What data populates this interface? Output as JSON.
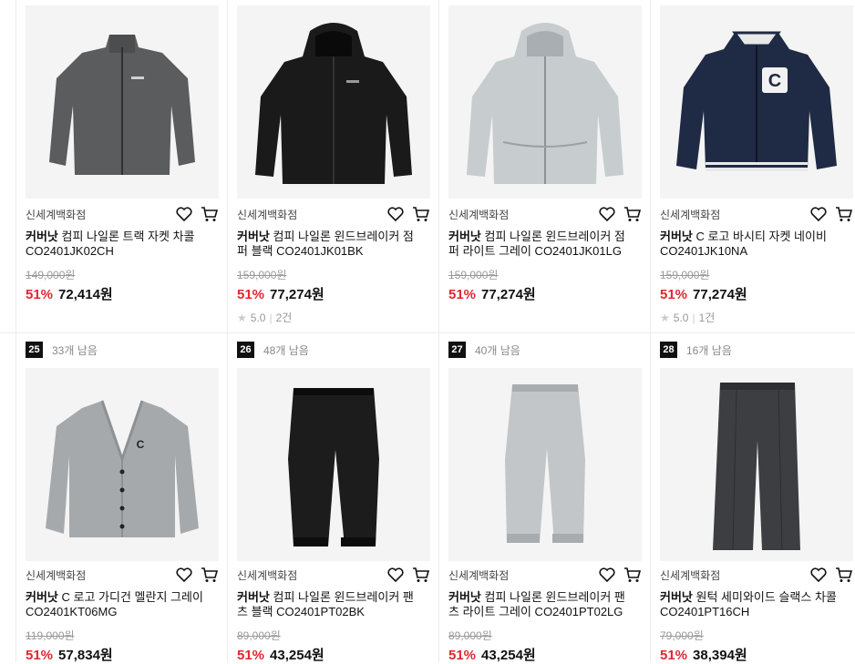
{
  "products": [
    {
      "rank": "",
      "stock": "",
      "seller": "신세계백화점",
      "brand": "커버낫",
      "name": " 컴피 나일론 트랙 자켓 차콜 CO2401JK02CH",
      "orig": "149,000원",
      "rate": "51%",
      "price": "72,414원",
      "rating": "",
      "reviews": "",
      "image": "track-jacket-charcoal"
    },
    {
      "rank": "",
      "stock": "",
      "seller": "신세계백화점",
      "brand": "커버낫",
      "name": " 컴피 나일론 윈드브레이커 점퍼 블랙 CO2401JK01BK",
      "orig": "159,000원",
      "rate": "51%",
      "price": "77,274원",
      "rating": "5.0",
      "reviews": "2건",
      "image": "windbreaker-black"
    },
    {
      "rank": "",
      "stock": "",
      "seller": "신세계백화점",
      "brand": "커버낫",
      "name": " 컴피 나일론 윈드브레이커 점퍼 라이트 그레이 CO2401JK01LG",
      "orig": "159,000원",
      "rate": "51%",
      "price": "77,274원",
      "rating": "",
      "reviews": "",
      "image": "windbreaker-grey"
    },
    {
      "rank": "",
      "stock": "",
      "seller": "신세계백화점",
      "brand": "커버낫",
      "name": " C 로고 바시티 자켓 네이비 CO2401JK10NA",
      "orig": "159,000원",
      "rate": "51%",
      "price": "77,274원",
      "rating": "5.0",
      "reviews": "1건",
      "image": "varsity-navy"
    },
    {
      "rank": "25",
      "stock": "33개 남음",
      "seller": "신세계백화점",
      "brand": "커버낫",
      "name": " C 로고 가디건 멜란지 그레이 CO2401KT06MG",
      "orig": "119,000원",
      "rate": "51%",
      "price": "57,834원",
      "rating": "",
      "reviews": "",
      "image": "cardigan-grey"
    },
    {
      "rank": "26",
      "stock": "48개 남음",
      "seller": "신세계백화점",
      "brand": "커버낫",
      "name": " 컴피 나일론 윈드브레이커 팬츠 블랙 CO2401PT02BK",
      "orig": "89,000원",
      "rate": "51%",
      "price": "43,254원",
      "rating": "",
      "reviews": "",
      "image": "pants-black"
    },
    {
      "rank": "27",
      "stock": "40개 남음",
      "seller": "신세계백화점",
      "brand": "커버낫",
      "name": " 컴피 나일론 윈드브레이커 팬츠 라이트 그레이 CO2401PT02LG",
      "orig": "89,000원",
      "rate": "51%",
      "price": "43,254원",
      "rating": "",
      "reviews": "",
      "image": "pants-grey"
    },
    {
      "rank": "28",
      "stock": "16개 남음",
      "seller": "신세계백화점",
      "brand": "커버낫",
      "name": " 원턱 세미와이드 슬랙스 차콜 CO2401PT16CH",
      "orig": "79,000원",
      "rate": "51%",
      "price": "38,394원",
      "rating": "",
      "reviews": "",
      "image": "slacks-charcoal"
    }
  ],
  "icons": {
    "wishlist": "heart-icon",
    "cart": "cart-icon",
    "star": "star-icon"
  },
  "colors": {
    "discount": "#e3262f",
    "rank_bg": "#111111"
  }
}
